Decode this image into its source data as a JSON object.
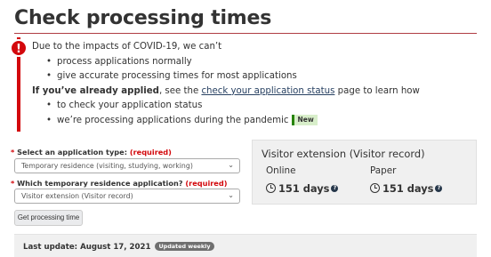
{
  "page": {
    "title": "Check processing times"
  },
  "alert": {
    "icon": "!",
    "intro": "Due to the impacts of COVID-19, we can’t",
    "cant_items": [
      "process applications normally",
      "give accurate processing times for most applications"
    ],
    "applied_bold": "If you’ve already applied",
    "applied_mid": ", see the ",
    "applied_link": "check your application status",
    "applied_end": " page to learn how",
    "learn_items": [
      "to check your application status",
      "we’re processing applications during the pandemic"
    ],
    "new_badge": "New"
  },
  "form": {
    "required_star": "*",
    "app_type_label": "Select an application type:",
    "app_type_required": "(required)",
    "app_type_value": "Temporary residence (visiting, studying, working)",
    "temp_label": "Which temporary residence application?",
    "temp_required": "(required)",
    "temp_value": "Visitor extension (Visitor record)",
    "submit_label": "Get processing time"
  },
  "result": {
    "title": "Visitor extension (Visitor record)",
    "online_label": "Online",
    "online_value": "151 days",
    "paper_label": "Paper",
    "paper_value": "151 days",
    "help_glyph": "?"
  },
  "update": {
    "text": "Last update: August 17, 2021",
    "badge": "Updated weekly"
  },
  "icons": {
    "alert": "exclamation-circle-icon",
    "clock": "clock-icon",
    "help": "question-circle-icon",
    "caret": "chevron-down-icon"
  },
  "colors": {
    "alert_red": "#d3080c",
    "title_rule": "#af3c43",
    "link": "#284162",
    "new_badge_bg": "#d8eeca",
    "new_badge_accent": "#278400",
    "panel_bg": "#f0f0f0"
  }
}
